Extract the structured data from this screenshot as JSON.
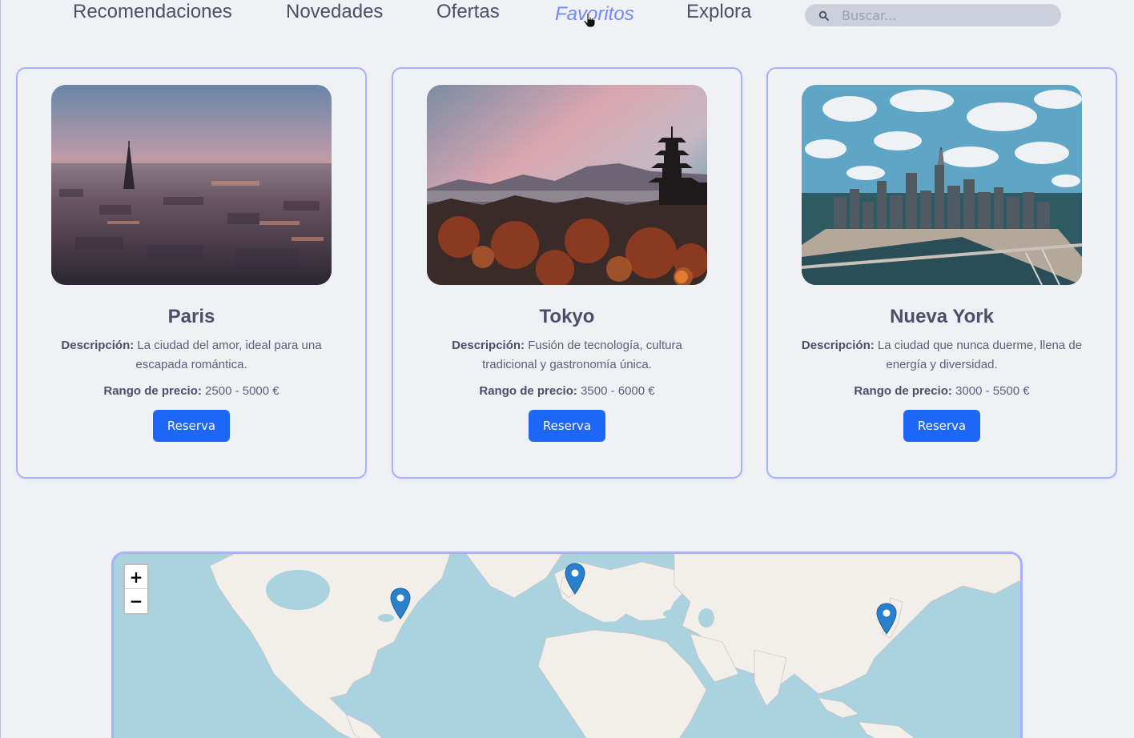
{
  "nav": {
    "items": [
      {
        "label": "Recomendaciones"
      },
      {
        "label": "Novedades"
      },
      {
        "label": "Ofertas"
      },
      {
        "label": "Favoritos",
        "active": true
      },
      {
        "label": "Explora"
      }
    ],
    "search": {
      "placeholder": "Buscar..."
    }
  },
  "cards": [
    {
      "title": "Paris",
      "desc_label": "Descripción:",
      "desc_text": "La ciudad del amor, ideal para una escapada romántica.",
      "price_label": "Rango de precio:",
      "price_text": "2500 - 5000 €",
      "button": "Reserva"
    },
    {
      "title": "Tokyo",
      "desc_label": "Descripción:",
      "desc_text": "Fusión de tecnología, cultura tradicional y gastronomía única.",
      "price_label": "Rango de precio:",
      "price_text": "3500 - 6000 €",
      "button": "Reserva"
    },
    {
      "title": "Nueva York",
      "desc_label": "Descripción:",
      "desc_text": "La ciudad que nunca duerme, llena de energía y diversidad.",
      "price_label": "Rango de precio:",
      "price_text": "3000 - 5500 €",
      "button": "Reserva"
    }
  ],
  "map": {
    "zoom_in": "+",
    "zoom_out": "−",
    "markers": [
      "paris",
      "new-york",
      "tokyo"
    ]
  },
  "colors": {
    "accent": "#7287fd",
    "button": "#1e66f5",
    "card_border": "#a7b2f7",
    "water": "#aad3df",
    "land": "#f2efe9"
  }
}
